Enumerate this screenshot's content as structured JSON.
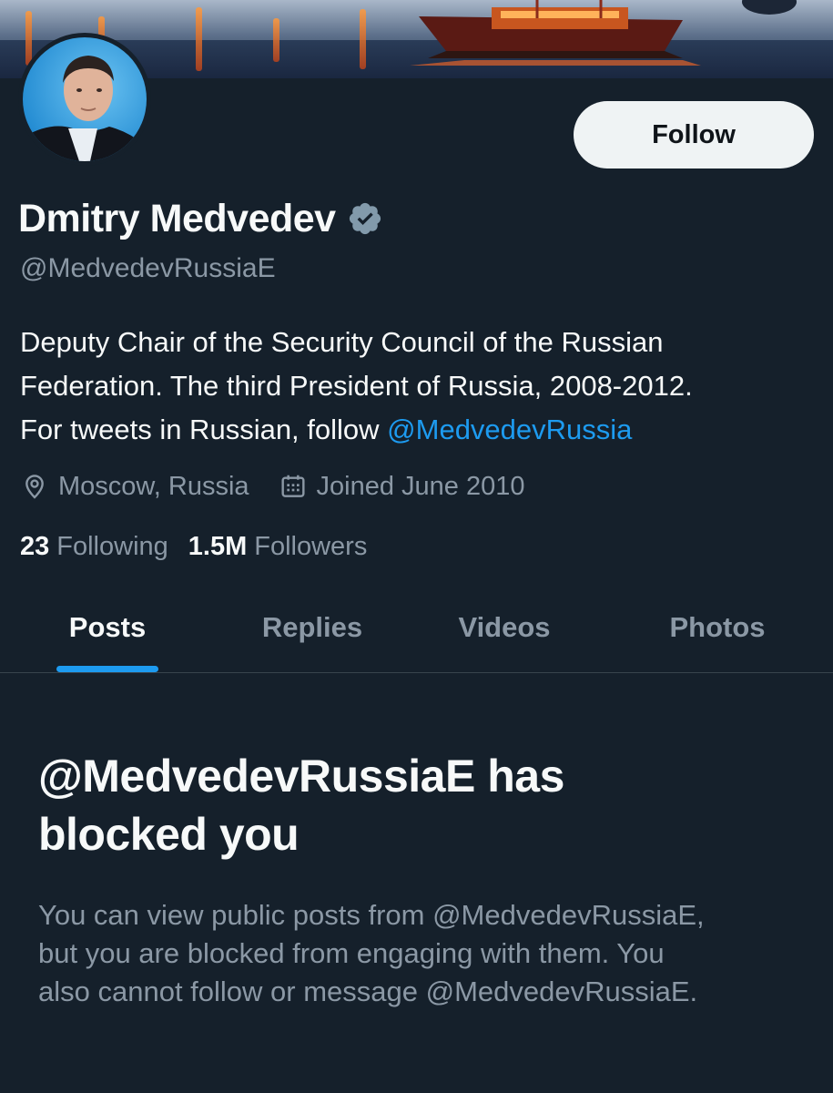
{
  "profile": {
    "display_name": "Dmitry Medvedev",
    "handle": "@MedvedevRussiaE",
    "verified": true,
    "bio_lines": [
      "Deputy Chair of the Security Council of the Russian",
      "Federation. The third President of Russia, 2008-2012.",
      "For tweets in Russian, follow "
    ],
    "bio_link": "@MedvedevRussia",
    "location": "Moscow, Russia",
    "joined": "Joined June 2010",
    "following_count": "23",
    "following_label": "Following",
    "followers_count": "1.5M",
    "followers_label": "Followers"
  },
  "actions": {
    "follow_label": "Follow"
  },
  "tabs": [
    {
      "label": "Posts",
      "active": true
    },
    {
      "label": "Replies",
      "active": false
    },
    {
      "label": "Videos",
      "active": false
    },
    {
      "label": "Photos",
      "active": false
    }
  ],
  "blocked": {
    "title_lines": [
      "@MedvedevRussiaE has",
      "blocked you"
    ],
    "body_lines": [
      "You can view public posts from @MedvedevRussiaE,",
      "but you are blocked from engaging with them. You",
      "also cannot follow or message @MedvedevRussiaE."
    ]
  },
  "icons": {
    "verified": "verified-badge-icon",
    "location": "location-pin-icon",
    "calendar": "calendar-icon"
  },
  "colors": {
    "background": "#15202b",
    "accent": "#1d9bf0",
    "secondary_text": "#8b98a5",
    "verified_badge": "#829aab"
  }
}
